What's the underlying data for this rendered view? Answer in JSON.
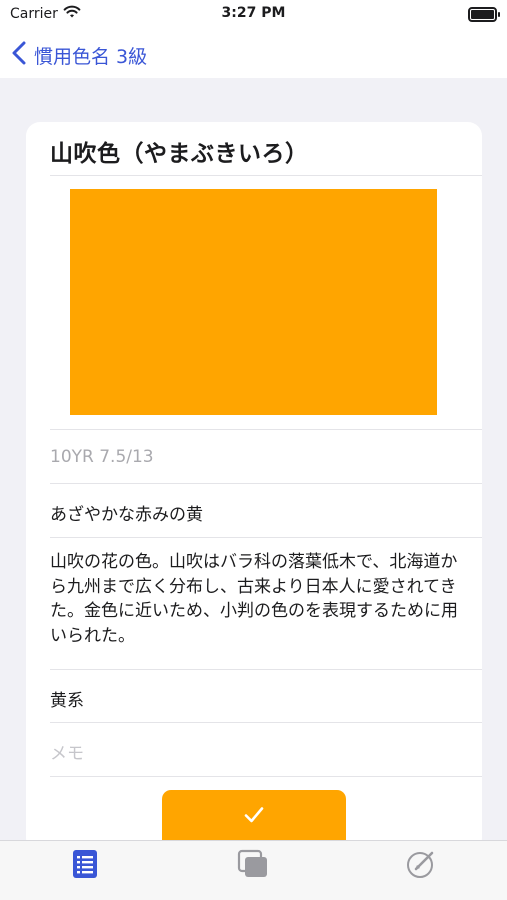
{
  "status_bar": {
    "carrier": "Carrier",
    "time": "3:27 PM"
  },
  "nav": {
    "back_label": "慣用色名 3級"
  },
  "color": {
    "name": "山吹色（やまぶきいろ）",
    "swatch_hex": "#FFA500",
    "munsell": "10YR 7.5/13",
    "short_description": "あざやかな赤みの黄",
    "description": "山吹の花の色。山吹はバラ科の落葉低木で、北海道から九州まで広く分布し、古来より日本人に愛されてきた。金色に近いため、小判の色のを表現するために用いられた。",
    "group": "黄系",
    "memo_placeholder": "メモ"
  },
  "accent": "#3a56d6",
  "tabs": [
    {
      "icon": "list-icon",
      "active": true
    },
    {
      "icon": "cards-icon",
      "active": false
    },
    {
      "icon": "edit-circle-icon",
      "active": false
    }
  ]
}
